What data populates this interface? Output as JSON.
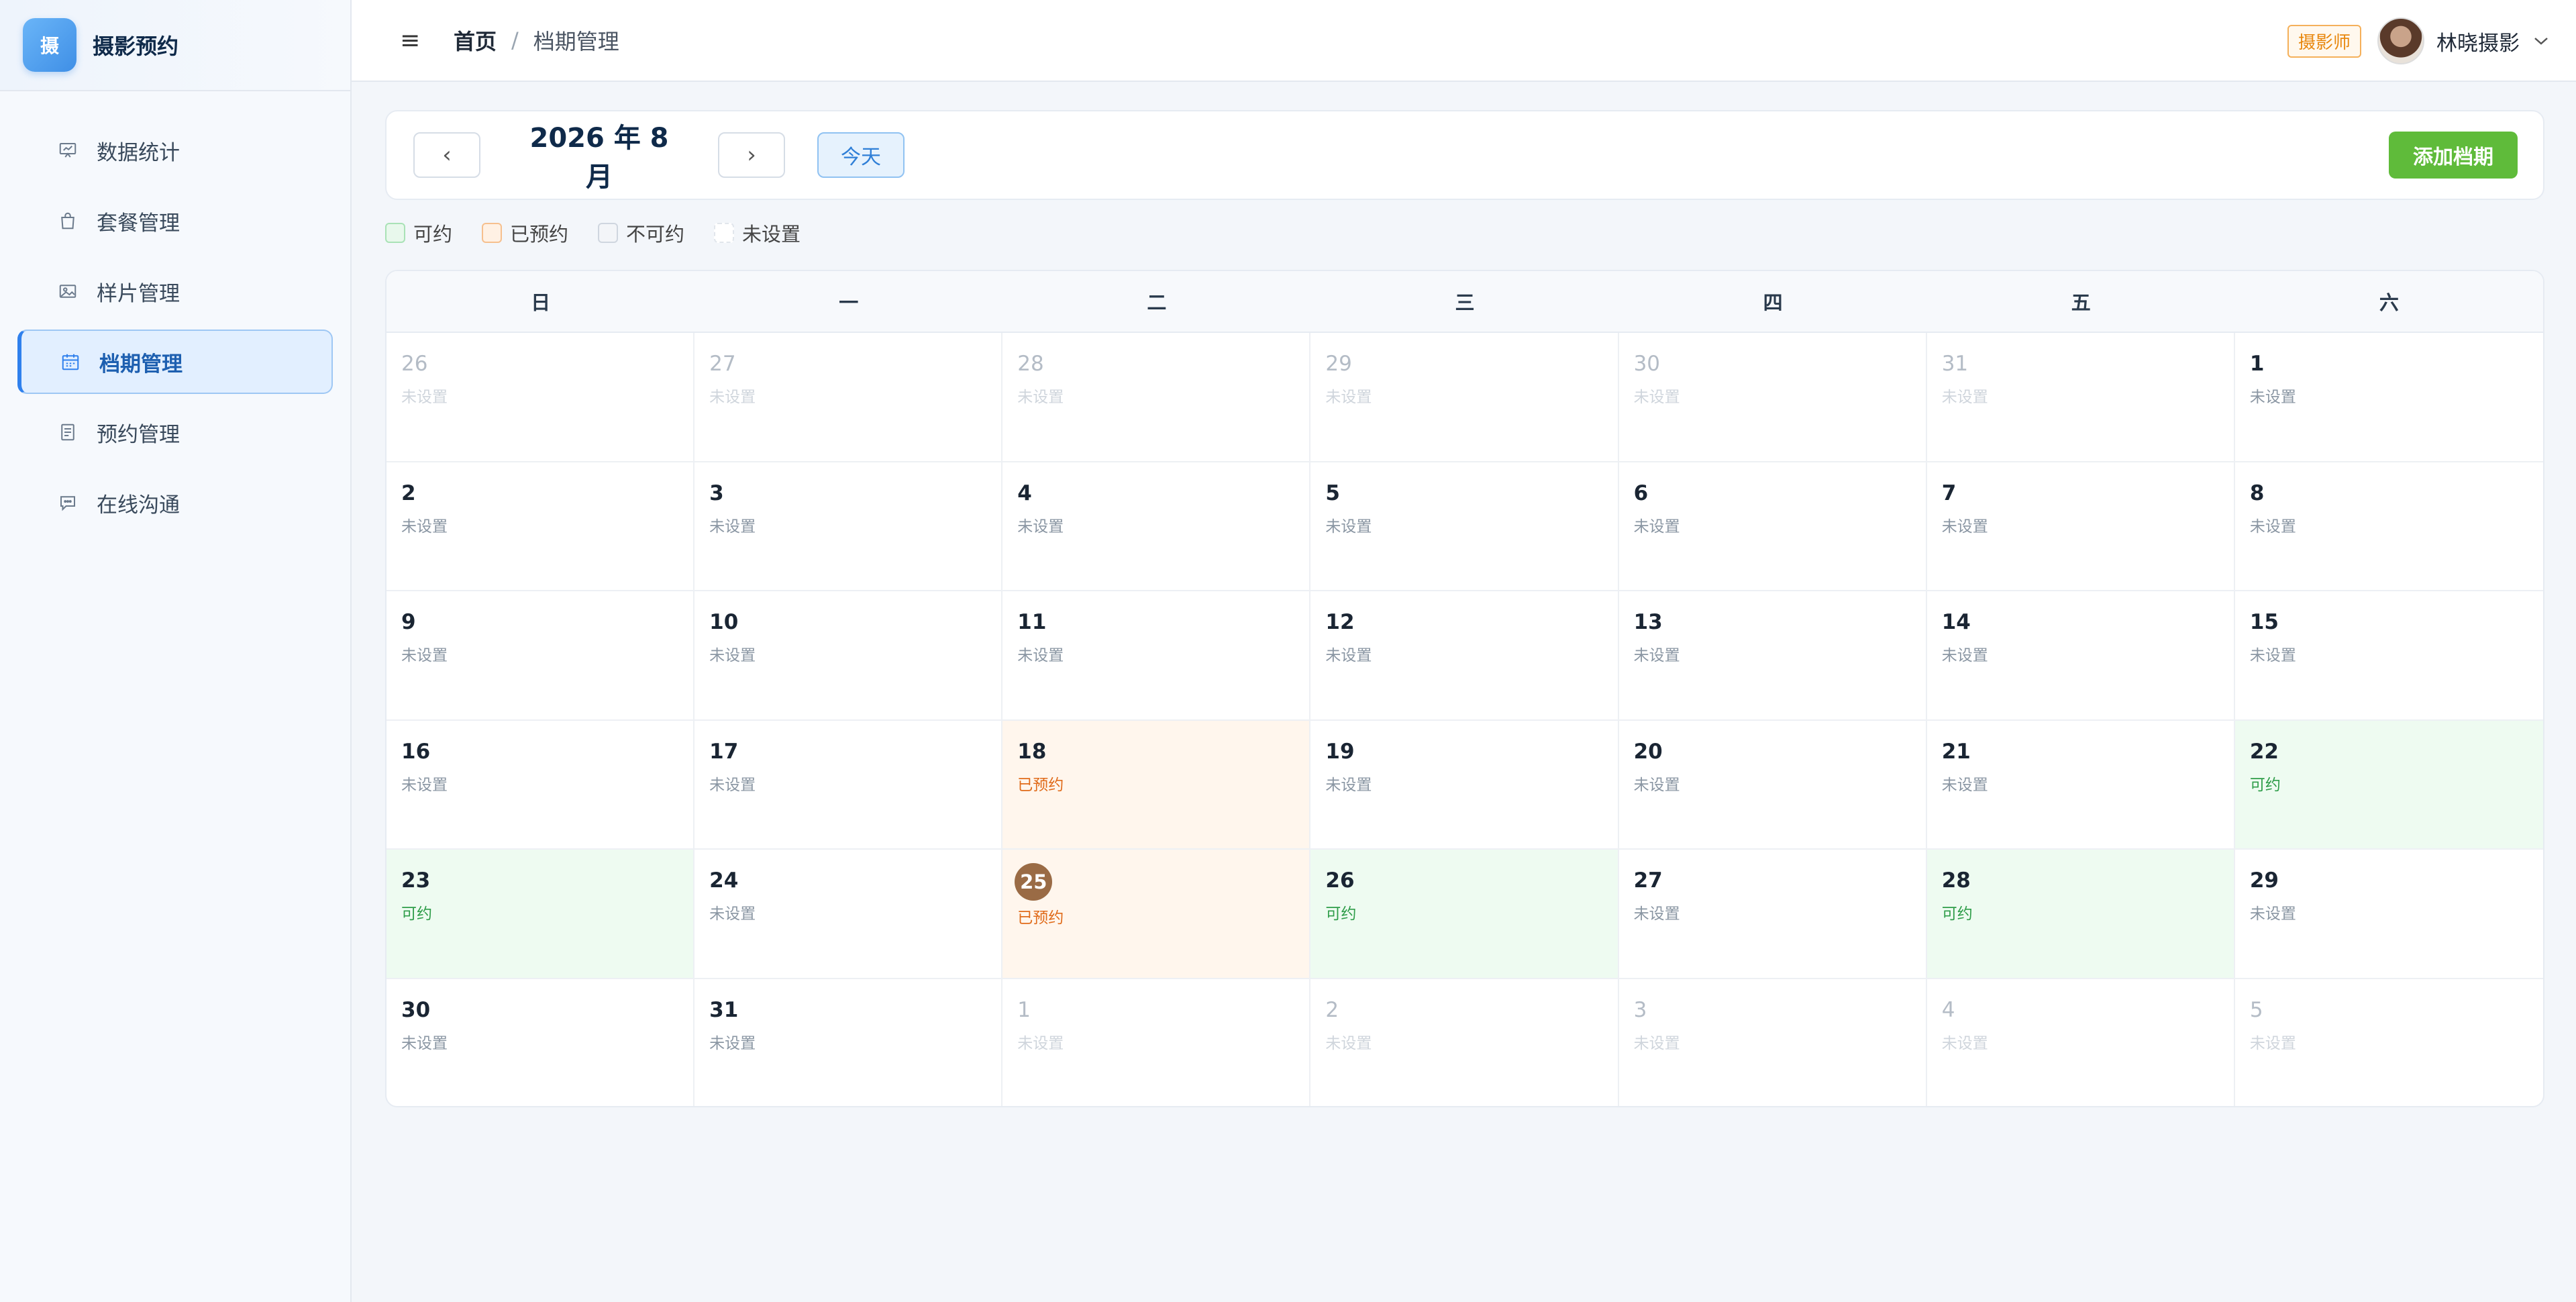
{
  "brand": {
    "logo_text": "摄",
    "name": "摄影预约"
  },
  "sidebar": {
    "items": [
      {
        "label": "数据统计",
        "icon": "chart-board-icon",
        "active": false
      },
      {
        "label": "套餐管理",
        "icon": "shopping-bag-icon",
        "active": false
      },
      {
        "label": "样片管理",
        "icon": "image-icon",
        "active": false
      },
      {
        "label": "档期管理",
        "icon": "calendar-icon",
        "active": true
      },
      {
        "label": "预约管理",
        "icon": "document-list-icon",
        "active": false
      },
      {
        "label": "在线沟通",
        "icon": "chat-bubble-icon",
        "active": false
      }
    ]
  },
  "header": {
    "menu_icon": "≡",
    "breadcrumb": {
      "home": "首页",
      "separator": "/",
      "current": "档期管理"
    },
    "role_badge": "摄影师",
    "user_name": "林晓摄影",
    "dropdown_icon": "chevron-down-icon"
  },
  "toolbar": {
    "prev_label": "‹",
    "next_label": "›",
    "month_title": "2026 年 8 月",
    "today_label": "今天",
    "add_label": "添加档期"
  },
  "legend": [
    {
      "label": "可约",
      "fill": "#e8f8ec",
      "border": "#a9e2b6"
    },
    {
      "label": "已预约",
      "fill": "#fff1e4",
      "border": "#f6c08e"
    },
    {
      "label": "不可约",
      "fill": "#f3f5f8",
      "border": "#cfd6df"
    },
    {
      "label": "未设置",
      "fill": "#ffffff",
      "border": "#e1e6ec"
    }
  ],
  "calendar": {
    "weekdays": [
      "日",
      "一",
      "二",
      "三",
      "四",
      "五",
      "六"
    ],
    "cells": [
      {
        "day": "26",
        "status": "未设置",
        "type": "other"
      },
      {
        "day": "27",
        "status": "未设置",
        "type": "other"
      },
      {
        "day": "28",
        "status": "未设置",
        "type": "other"
      },
      {
        "day": "29",
        "status": "未设置",
        "type": "other"
      },
      {
        "day": "30",
        "status": "未设置",
        "type": "other"
      },
      {
        "day": "31",
        "status": "未设置",
        "type": "other"
      },
      {
        "day": "1",
        "status": "未设置",
        "type": "unset"
      },
      {
        "day": "2",
        "status": "未设置",
        "type": "unset"
      },
      {
        "day": "3",
        "status": "未设置",
        "type": "unset"
      },
      {
        "day": "4",
        "status": "未设置",
        "type": "unset"
      },
      {
        "day": "5",
        "status": "未设置",
        "type": "unset"
      },
      {
        "day": "6",
        "status": "未设置",
        "type": "unset"
      },
      {
        "day": "7",
        "status": "未设置",
        "type": "unset"
      },
      {
        "day": "8",
        "status": "未设置",
        "type": "unset"
      },
      {
        "day": "9",
        "status": "未设置",
        "type": "unset"
      },
      {
        "day": "10",
        "status": "未设置",
        "type": "unset"
      },
      {
        "day": "11",
        "status": "未设置",
        "type": "unset"
      },
      {
        "day": "12",
        "status": "未设置",
        "type": "unset"
      },
      {
        "day": "13",
        "status": "未设置",
        "type": "unset"
      },
      {
        "day": "14",
        "status": "未设置",
        "type": "unset"
      },
      {
        "day": "15",
        "status": "未设置",
        "type": "unset"
      },
      {
        "day": "16",
        "status": "未设置",
        "type": "unset"
      },
      {
        "day": "17",
        "status": "未设置",
        "type": "unset"
      },
      {
        "day": "18",
        "status": "已预约",
        "type": "booked"
      },
      {
        "day": "19",
        "status": "未设置",
        "type": "unset"
      },
      {
        "day": "20",
        "status": "未设置",
        "type": "unset"
      },
      {
        "day": "21",
        "status": "未设置",
        "type": "unset"
      },
      {
        "day": "22",
        "status": "可约",
        "type": "available"
      },
      {
        "day": "23",
        "status": "可约",
        "type": "available"
      },
      {
        "day": "24",
        "status": "未设置",
        "type": "unset"
      },
      {
        "day": "25",
        "status": "已预约",
        "type": "booked",
        "today": true
      },
      {
        "day": "26",
        "status": "可约",
        "type": "available"
      },
      {
        "day": "27",
        "status": "未设置",
        "type": "unset"
      },
      {
        "day": "28",
        "status": "可约",
        "type": "available"
      },
      {
        "day": "29",
        "status": "未设置",
        "type": "unset"
      },
      {
        "day": "30",
        "status": "未设置",
        "type": "unset"
      },
      {
        "day": "31",
        "status": "未设置",
        "type": "unset"
      },
      {
        "day": "1",
        "status": "未设置",
        "type": "other"
      },
      {
        "day": "2",
        "status": "未设置",
        "type": "other"
      },
      {
        "day": "3",
        "status": "未设置",
        "type": "other"
      },
      {
        "day": "4",
        "status": "未设置",
        "type": "other"
      },
      {
        "day": "5",
        "status": "未设置",
        "type": "other"
      }
    ]
  },
  "colors": {
    "accent": "#2f80ed",
    "add_button": "#5fbb3a",
    "booked_text": "#e06b1a",
    "available_text": "#2e9d49",
    "today_circle": "#9a6b45"
  }
}
